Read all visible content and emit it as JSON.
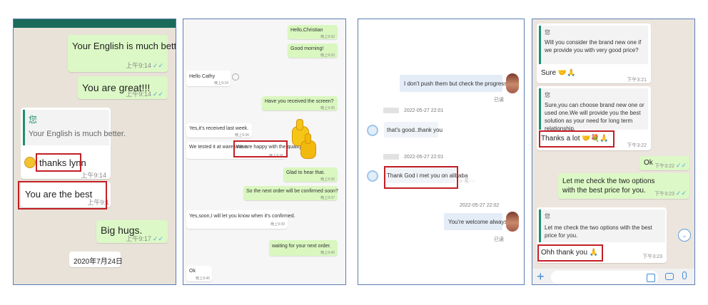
{
  "panel1": {
    "messages": [
      {
        "text": "Your English is much better.",
        "time": "上午9:14"
      },
      {
        "text": "You are great!!!",
        "time": "上午9:14"
      },
      {
        "quote_name": "您",
        "quote_text": "Your English is much better.",
        "text": "thanks lynn",
        "time": "上午9:14"
      },
      {
        "text": "You are the best",
        "time": "上午9:1"
      },
      {
        "text": "Big hugs.",
        "time": "上午9:17"
      }
    ],
    "date_chip": "2020年7月24日"
  },
  "panel2": {
    "messages": [
      {
        "text": "Hello,Christian",
        "time": "晚上9:32"
      },
      {
        "text": "Good morning!",
        "time": "晚上9:33"
      },
      {
        "text": "Hello Cathy",
        "time": "晚上9:34"
      },
      {
        "text": "Have you received the screen?",
        "time": "晚上9:35"
      },
      {
        "text": "Yes,it's received last week.",
        "time": "晚上9:36"
      },
      {
        "text": "We tested it at warehouse.",
        "text2": "We are happy with the quality.",
        "time": "晚上9:36"
      },
      {
        "text": "Glad to hear that.",
        "time": "晚上9:36"
      },
      {
        "text": "So the next order will be confirmed soon?",
        "time": "晚上9:37"
      },
      {
        "text": "Yes,soon,I will let you know when it's confirmed.",
        "time": "晚上9:39"
      },
      {
        "text": "waiting for your next order.",
        "time": "晚上9:40"
      },
      {
        "text": "Ok",
        "time": "晚上9:46"
      }
    ],
    "thumbs_icon": "thumbs-up-emoji"
  },
  "panel3": {
    "messages": [
      {
        "text": "I don't push them but check the progress only",
        "status": "已读"
      },
      {
        "sender_time": "2022-05-27 22:01",
        "text": "that's good..thank you"
      },
      {
        "sender_time": "2022-05-27 22:01",
        "text": "Thank God i met you on alibaba"
      },
      {
        "timestamp": "2022-05-27 22:02",
        "text": "You're welcome always.",
        "status": "已读"
      }
    ],
    "extra_icons": "☺ ⎘ ···"
  },
  "panel4": {
    "messages": [
      {
        "quote_name": "您",
        "quote_text": "Will you consider the brand new one if we provide you with very good price?",
        "text": "Sure 🤝🙏",
        "time": "下午3:21"
      },
      {
        "quote_name": "您",
        "quote_text": "Sure,you can choose brand new one or used one.We will provide you the best solution as your need for long term relationship.",
        "text": "Thanks a lot 🤝💐🙏",
        "time": "下午3:22"
      },
      {
        "text": "Ok",
        "time": "下午3:22"
      },
      {
        "text": "Let me check the two options with the best price for you.",
        "time": "下午3:23"
      },
      {
        "quote_name": "您",
        "quote_text": "Let me check the two options with the best price for you.",
        "text": "Ohh thank you 🙏",
        "time": "下午3:23"
      }
    ]
  }
}
